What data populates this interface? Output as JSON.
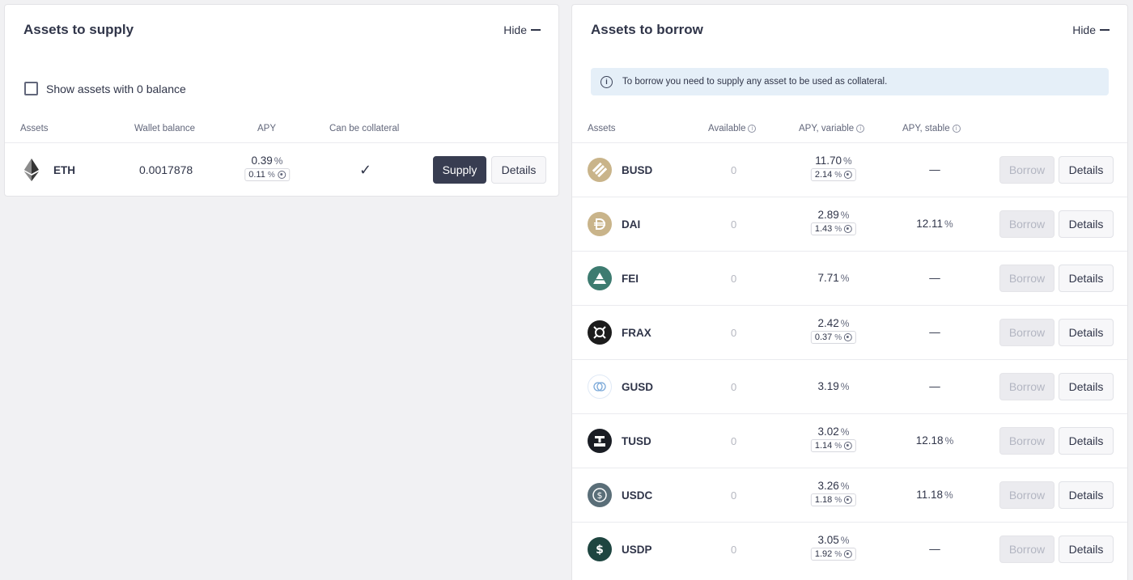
{
  "supply": {
    "title": "Assets to supply",
    "hide_label": "Hide",
    "show_zero_label": "Show assets with 0 balance",
    "columns": [
      "Assets",
      "Wallet balance",
      "APY",
      "Can be collateral"
    ],
    "rows": [
      {
        "symbol": "ETH",
        "wallet_balance": "0.0017878",
        "apy": "0.39",
        "incentive": "0.11",
        "collateral": "✓",
        "supply_label": "Supply",
        "details_label": "Details"
      }
    ]
  },
  "borrow": {
    "title": "Assets to borrow",
    "hide_label": "Hide",
    "alert": "To borrow you need to supply any asset to be used as collateral.",
    "columns": [
      "Assets",
      "Available",
      "APY, variable",
      "APY, stable"
    ],
    "percent_sign": "%",
    "rows": [
      {
        "symbol": "BUSD",
        "available": "0",
        "apy_variable": "11.70",
        "incentive": "2.14",
        "apy_stable": "—",
        "borrow_label": "Borrow",
        "details_label": "Details"
      },
      {
        "symbol": "DAI",
        "available": "0",
        "apy_variable": "2.89",
        "incentive": "1.43",
        "apy_stable": "12.11",
        "borrow_label": "Borrow",
        "details_label": "Details"
      },
      {
        "symbol": "FEI",
        "available": "0",
        "apy_variable": "7.71",
        "incentive": "",
        "apy_stable": "—",
        "borrow_label": "Borrow",
        "details_label": "Details"
      },
      {
        "symbol": "FRAX",
        "available": "0",
        "apy_variable": "2.42",
        "incentive": "0.37",
        "apy_stable": "—",
        "borrow_label": "Borrow",
        "details_label": "Details"
      },
      {
        "symbol": "GUSD",
        "available": "0",
        "apy_variable": "3.19",
        "incentive": "",
        "apy_stable": "—",
        "borrow_label": "Borrow",
        "details_label": "Details"
      },
      {
        "symbol": "TUSD",
        "available": "0",
        "apy_variable": "3.02",
        "incentive": "1.14",
        "apy_stable": "12.18",
        "borrow_label": "Borrow",
        "details_label": "Details"
      },
      {
        "symbol": "USDC",
        "available": "0",
        "apy_variable": "3.26",
        "incentive": "1.18",
        "apy_stable": "11.18",
        "borrow_label": "Borrow",
        "details_label": "Details"
      },
      {
        "symbol": "USDP",
        "available": "0",
        "apy_variable": "3.05",
        "incentive": "1.92",
        "apy_stable": "—",
        "borrow_label": "Borrow",
        "details_label": "Details"
      }
    ]
  },
  "icons": {
    "ETH": "ethereum-icon",
    "BUSD": "busd-icon",
    "DAI": "dai-icon",
    "FEI": "fei-icon",
    "FRAX": "frax-icon",
    "GUSD": "gusd-icon",
    "TUSD": "tusd-icon",
    "USDC": "usdc-icon",
    "USDP": "usdp-icon"
  },
  "colors": {
    "primary_dark": "#383d51",
    "alert_bg": "#e5eff8",
    "disabled_bg": "#ebebef"
  }
}
